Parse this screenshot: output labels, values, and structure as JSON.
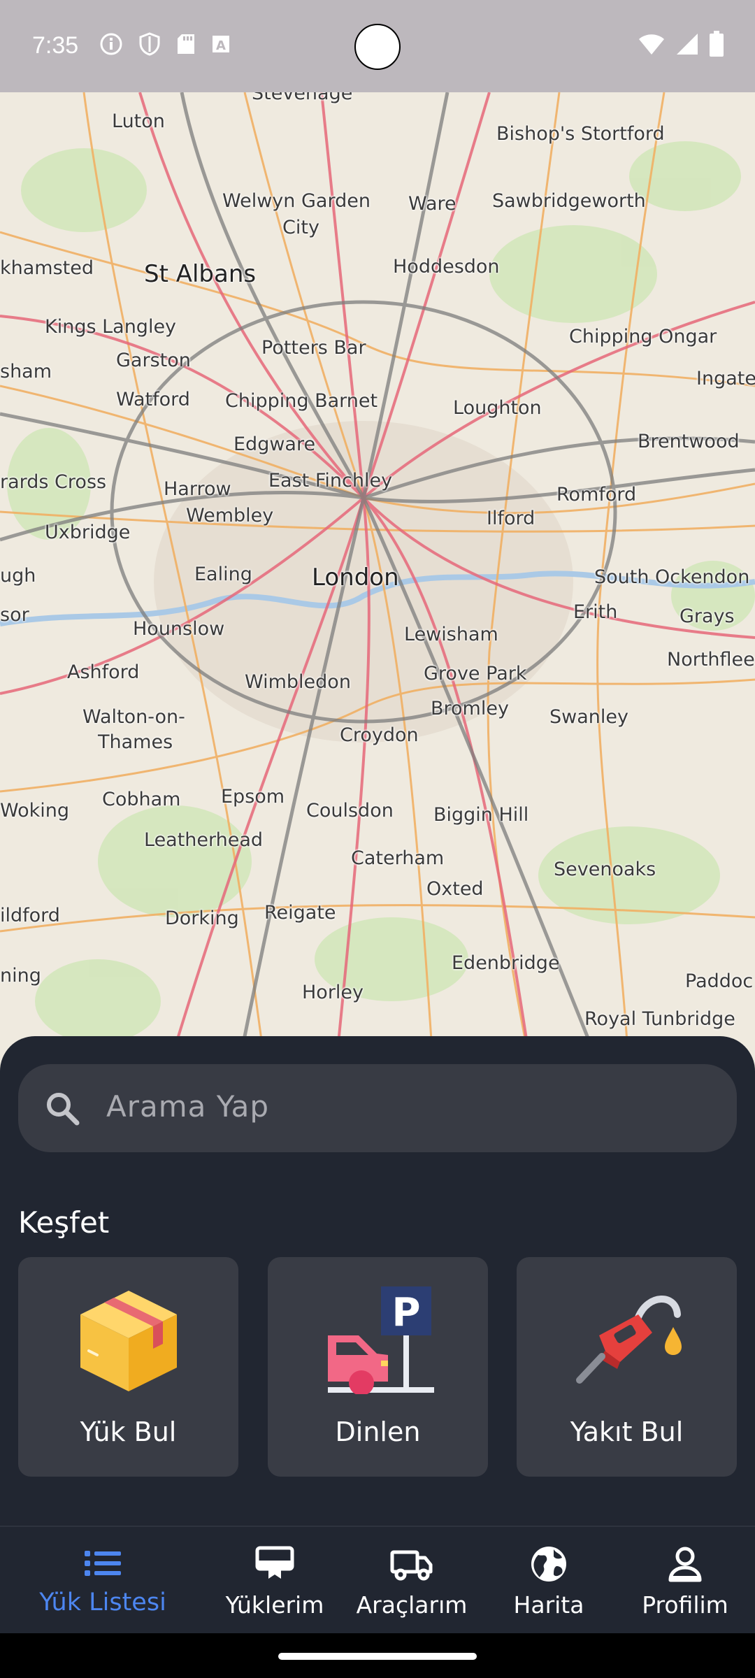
{
  "status_bar": {
    "time": "7:35",
    "left_icons": [
      "info-icon",
      "shield-icon",
      "sd-card-icon",
      "text-a-icon"
    ],
    "right_icons": [
      "wifi-icon",
      "signal-icon",
      "battery-icon"
    ]
  },
  "map": {
    "labels": [
      {
        "text": "Stevenage"
      },
      {
        "text": "Luton"
      },
      {
        "text": "Bishop's Stortford"
      },
      {
        "text": "Welwyn Garden"
      },
      {
        "text": "City"
      },
      {
        "text": "Ware"
      },
      {
        "text": "Sawbridgeworth"
      },
      {
        "text": "khamsted"
      },
      {
        "text": "St Albans"
      },
      {
        "text": "Hoddesdon"
      },
      {
        "text": "Kings Langley"
      },
      {
        "text": "Garston"
      },
      {
        "text": "Potters Bar"
      },
      {
        "text": "Chipping Ongar"
      },
      {
        "text": "sham"
      },
      {
        "text": "Ingate"
      },
      {
        "text": "Watford"
      },
      {
        "text": "Chipping Barnet"
      },
      {
        "text": "Loughton"
      },
      {
        "text": "Edgware"
      },
      {
        "text": "Brentwood"
      },
      {
        "text": "rards Cross"
      },
      {
        "text": "Harrow"
      },
      {
        "text": "East Finchley"
      },
      {
        "text": "Romford"
      },
      {
        "text": "Wembley"
      },
      {
        "text": "Ilford"
      },
      {
        "text": "Uxbridge"
      },
      {
        "text": "ugh"
      },
      {
        "text": "Ealing"
      },
      {
        "text": "London"
      },
      {
        "text": "South Ockendon"
      },
      {
        "text": "sor"
      },
      {
        "text": "Erith"
      },
      {
        "text": "Grays"
      },
      {
        "text": "Hounslow"
      },
      {
        "text": "Lewisham"
      },
      {
        "text": "Ashford"
      },
      {
        "text": "Grove Park"
      },
      {
        "text": "Northflee"
      },
      {
        "text": "Wimbledon"
      },
      {
        "text": "Bromley"
      },
      {
        "text": "Walton-on-"
      },
      {
        "text": "Swanley"
      },
      {
        "text": "Thames"
      },
      {
        "text": "Croydon"
      },
      {
        "text": "Cobham"
      },
      {
        "text": "Epsom"
      },
      {
        "text": "Woking"
      },
      {
        "text": "Coulsdon"
      },
      {
        "text": "Biggin Hill"
      },
      {
        "text": "Leatherhead"
      },
      {
        "text": "Caterham"
      },
      {
        "text": "Sevenoaks"
      },
      {
        "text": "Oxted"
      },
      {
        "text": "ildford"
      },
      {
        "text": "Dorking"
      },
      {
        "text": "Reigate"
      },
      {
        "text": "Edenbridge"
      },
      {
        "text": "ning"
      },
      {
        "text": "Paddoc"
      },
      {
        "text": "Horley"
      },
      {
        "text": "Royal Tunbridge"
      }
    ]
  },
  "search": {
    "placeholder": "Arama Yap",
    "icon": "search-icon"
  },
  "discover": {
    "title": "Keşfet",
    "cards": [
      {
        "label": "Yük Bul",
        "icon": "cardboard-box-icon"
      },
      {
        "label": "Dinlen",
        "icon": "parking-rest-icon"
      },
      {
        "label": "Yakıt Bul",
        "icon": "fuel-nozzle-icon"
      }
    ]
  },
  "bottom_nav": {
    "items": [
      {
        "label": "Yük Listesi",
        "icon": "list-icon",
        "active": true
      },
      {
        "label": "Yüklerim",
        "icon": "pickup-icon",
        "active": false
      },
      {
        "label": "Araçlarım",
        "icon": "truck-icon",
        "active": false
      },
      {
        "label": "Harita",
        "icon": "globe-icon",
        "active": false
      },
      {
        "label": "Profilim",
        "icon": "person-icon",
        "active": false
      }
    ],
    "active_color": "#4d86f0"
  },
  "colors": {
    "sheet_bg": "#212631",
    "card_bg": "#393c45",
    "search_bg": "#383b44",
    "status_bar_bg": "#bdb8bd",
    "map_bg": "#efeadf"
  }
}
